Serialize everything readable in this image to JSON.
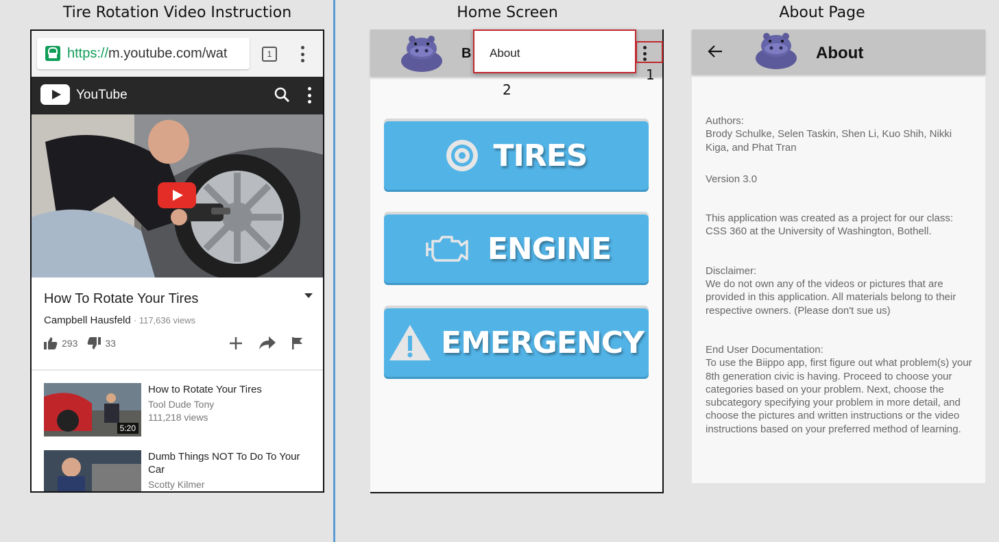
{
  "captions": {
    "youtube": "Tire Rotation Video Instruction",
    "home": "Home Screen",
    "about": "About Page"
  },
  "youtube": {
    "url_scheme": "https://",
    "url_rest": "m.youtube.com/wat",
    "tab_count": "1",
    "brand": "YouTube",
    "video_title": "How To Rotate Your Tires",
    "channel": "Campbell Hausfeld",
    "views": "· 117,636 views",
    "likes": "293",
    "dislikes": "33",
    "related": [
      {
        "title": "How to Rotate Your Tires",
        "channel": "Tool Dude Tony",
        "views": "111,218 views",
        "duration": "5:20"
      },
      {
        "title": "Dumb Things NOT To Do To Your Car",
        "channel": "Scotty Kilmer",
        "views": "",
        "duration": ""
      }
    ],
    "icons": [
      "lock-icon",
      "tabs-icon",
      "more-vert-icon",
      "youtube-logo-icon",
      "search-icon",
      "play-icon",
      "thumbs-up-icon",
      "thumbs-down-icon",
      "add-icon",
      "share-icon",
      "flag-icon"
    ]
  },
  "home": {
    "title_partial": "B",
    "menu_item": "About",
    "annotation_menu": "1",
    "annotation_popup": "2",
    "buttons": [
      {
        "label": "TIRES",
        "icon": "tire-icon"
      },
      {
        "label": "ENGINE",
        "icon": "engine-icon"
      },
      {
        "label": "EMERGENCY",
        "icon": "warning-icon"
      }
    ],
    "accent": "#52b3e6",
    "highlight": "#c0272d"
  },
  "about": {
    "title": "About",
    "authors_label": "Authors:",
    "authors": "Brody Schulke, Selen Taskin, Shen Li, Kuo Shih, Nikki Kiga, and Phat Tran",
    "version": "Version 3.0",
    "class_info": "This application was created as a project for our class: CSS 360 at the University of Washington, Bothell.",
    "disclaimer_label": "Disclaimer:",
    "disclaimer": "We do not own any of the videos or pictures that are provided in this application. All materials belong to their respective owners. (Please don't sue us)",
    "docs_label": "End User Documentation:",
    "docs": "To use the Biippo app, first figure out what problem(s) your 8th generation civic is having. Proceed to choose your categories based on your problem. Next, choose the subcategory specifying your problem in more detail, and choose the pictures and written instructions or the video instructions based on your preferred method of learning."
  }
}
